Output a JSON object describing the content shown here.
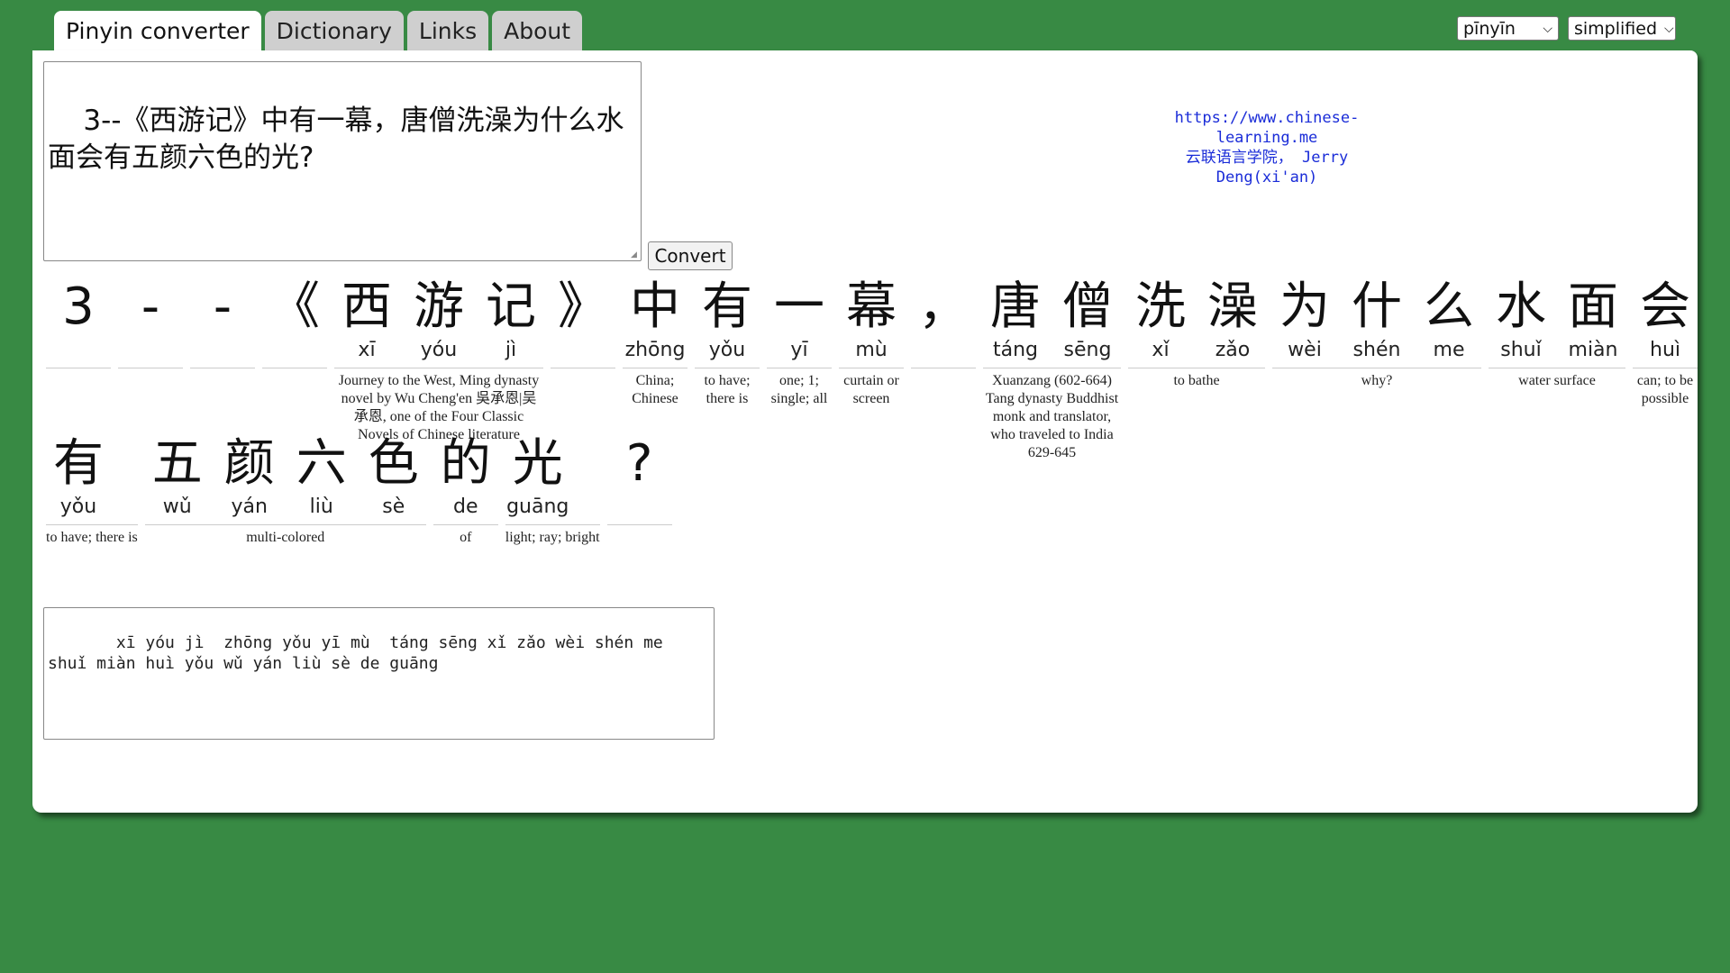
{
  "tabs": [
    {
      "label": "Pinyin converter",
      "active": true
    },
    {
      "label": "Dictionary",
      "active": false
    },
    {
      "label": "Links",
      "active": false
    },
    {
      "label": "About",
      "active": false
    }
  ],
  "selectors": {
    "pinyin_mode": "pīnyīn",
    "script": "simplified"
  },
  "input": {
    "value": "3--《西游记》中有一幕，唐僧洗澡为什么水面会有五颜六色的光?"
  },
  "convert_label": "Convert",
  "credit": {
    "url": "https://www.chinese-learning.me",
    "author": "云联语言学院， Jerry Deng(xi'an)"
  },
  "rows": [
    [
      {
        "chars": [
          {
            "h": "3",
            "p": ""
          }
        ],
        "gloss": ""
      },
      {
        "chars": [
          {
            "h": "-",
            "p": ""
          }
        ],
        "gloss": ""
      },
      {
        "chars": [
          {
            "h": "-",
            "p": ""
          }
        ],
        "gloss": ""
      },
      {
        "chars": [
          {
            "h": "《",
            "p": ""
          }
        ],
        "gloss": ""
      },
      {
        "chars": [
          {
            "h": "西",
            "p": "xī"
          },
          {
            "h": "游",
            "p": "yóu"
          },
          {
            "h": "记",
            "p": "jì"
          }
        ],
        "gloss": "Journey to the West, Ming dynasty novel by Wu Cheng'en 吳承恩|吴承恩, one of the Four Classic Novels of Chinese literature"
      },
      {
        "chars": [
          {
            "h": "》",
            "p": ""
          }
        ],
        "gloss": ""
      },
      {
        "chars": [
          {
            "h": "中",
            "p": "zhōng"
          }
        ],
        "gloss": "China; Chinese"
      },
      {
        "chars": [
          {
            "h": "有",
            "p": "yǒu"
          }
        ],
        "gloss": "to have; there is"
      },
      {
        "chars": [
          {
            "h": "一",
            "p": "yī"
          }
        ],
        "gloss": "one; 1; single; all"
      },
      {
        "chars": [
          {
            "h": "幕",
            "p": "mù"
          }
        ],
        "gloss": "curtain or screen"
      },
      {
        "chars": [
          {
            "h": "，",
            "p": ""
          }
        ],
        "gloss": ""
      },
      {
        "chars": [
          {
            "h": "唐",
            "p": "táng"
          },
          {
            "h": "僧",
            "p": "sēng"
          }
        ],
        "gloss": "Xuanzang (602-664) Tang dynasty Buddhist monk and translator, who traveled to India 629-645"
      },
      {
        "chars": [
          {
            "h": "洗",
            "p": "xǐ"
          },
          {
            "h": "澡",
            "p": "zǎo"
          }
        ],
        "gloss": "to bathe"
      },
      {
        "chars": [
          {
            "h": "为",
            "p": "wèi"
          },
          {
            "h": "什",
            "p": "shén"
          },
          {
            "h": "么",
            "p": "me"
          }
        ],
        "gloss": "why?"
      },
      {
        "chars": [
          {
            "h": "水",
            "p": "shuǐ"
          },
          {
            "h": "面",
            "p": "miàn"
          }
        ],
        "gloss": "water surface"
      },
      {
        "chars": [
          {
            "h": "会",
            "p": "huì"
          }
        ],
        "gloss": "can; to be possible"
      }
    ],
    [
      {
        "chars": [
          {
            "h": "有",
            "p": "yǒu"
          }
        ],
        "gloss": "to have; there is"
      },
      {
        "chars": [
          {
            "h": "五",
            "p": "wǔ"
          },
          {
            "h": "颜",
            "p": "yán"
          },
          {
            "h": "六",
            "p": "liù"
          },
          {
            "h": "色",
            "p": "sè"
          }
        ],
        "gloss": "multi-colored"
      },
      {
        "chars": [
          {
            "h": "的",
            "p": "de"
          }
        ],
        "gloss": "of"
      },
      {
        "chars": [
          {
            "h": "光",
            "p": "guāng"
          }
        ],
        "gloss": "light; ray; bright"
      },
      {
        "chars": [
          {
            "h": "?",
            "p": ""
          }
        ],
        "gloss": ""
      }
    ]
  ],
  "output": {
    "value": "   xī yóu jì  zhōng yǒu yī mù  táng sēng xǐ zǎo wèi shén me\nshuǐ miàn huì yǒu wǔ yán liù sè de guāng"
  }
}
